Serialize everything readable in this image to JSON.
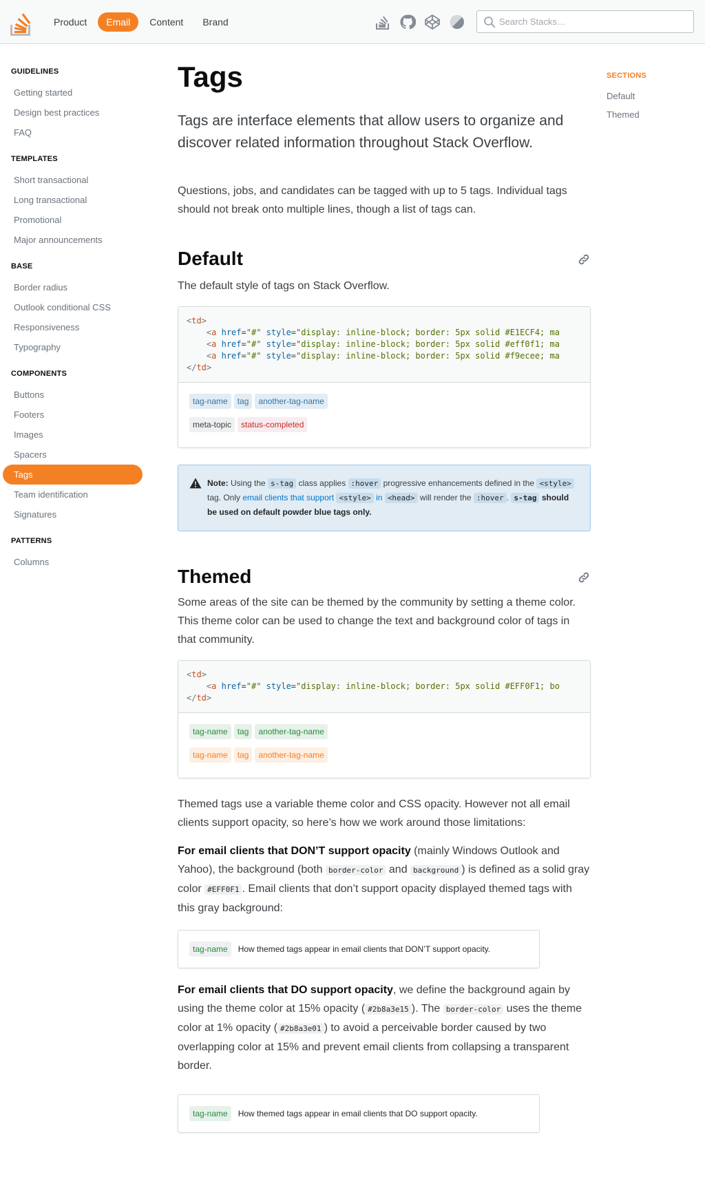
{
  "header": {
    "nav": [
      {
        "label": "Product",
        "active": false
      },
      {
        "label": "Email",
        "active": true
      },
      {
        "label": "Content",
        "active": false
      },
      {
        "label": "Brand",
        "active": false
      }
    ],
    "tool_icons": [
      "stack-overflow-icon",
      "github-icon",
      "codepen-icon",
      "theme-toggle-icon"
    ],
    "search": {
      "placeholder": "Search Stacks…",
      "value": ""
    }
  },
  "sidebar": {
    "groups": [
      {
        "heading": "GUIDELINES",
        "items": [
          "Getting started",
          "Design best practices",
          "FAQ"
        ]
      },
      {
        "heading": "TEMPLATES",
        "items": [
          "Short transactional",
          "Long transactional",
          "Promotional",
          "Major announcements"
        ]
      },
      {
        "heading": "BASE",
        "items": [
          "Border radius",
          "Outlook conditional CSS",
          "Responsiveness",
          "Typography"
        ]
      },
      {
        "heading": "COMPONENTS",
        "items": [
          "Buttons",
          "Footers",
          "Images",
          "Spacers",
          "Tags",
          "Team identification",
          "Signatures"
        ]
      },
      {
        "heading": "PATTERNS",
        "items": [
          "Columns"
        ]
      }
    ],
    "active_item": "Tags"
  },
  "sections": {
    "heading": "SECTIONS",
    "items": [
      "Default",
      "Themed"
    ]
  },
  "page": {
    "title": "Tags",
    "lead": "Tags are interface elements that allow users to organize and discover related information throughout Stack Overflow.",
    "intro": "Questions, jobs, and candidates can be tagged with up to 5 tags. Individual tags should not break onto multiple lines, though a list of tags can."
  },
  "default_section": {
    "title": "Default",
    "description": "The default style of tags on Stack Overflow.",
    "code": {
      "open": "td",
      "lines": [
        {
          "tag": "a",
          "href": "\"#\"",
          "style": "\"display: inline-block; border: 5px solid #E1ECF4; ma"
        },
        {
          "tag": "a",
          "href": "\"#\"",
          "style": "\"display: inline-block; border: 5px solid #eff0f1; ma"
        },
        {
          "tag": "a",
          "href": "\"#\"",
          "style": "\"display: inline-block; border: 5px solid #f9ecee; ma"
        }
      ],
      "close": "td"
    },
    "tag_rows": [
      [
        {
          "label": "tag-name",
          "bg": "#E1ECF4",
          "color": "#39739d"
        },
        {
          "label": "tag",
          "bg": "#E1ECF4",
          "color": "#39739d"
        },
        {
          "label": "another-tag-name",
          "bg": "#E1ECF4",
          "color": "#39739d"
        }
      ],
      [
        {
          "label": "meta-topic",
          "bg": "#eff0f1",
          "color": "#3b4045"
        },
        {
          "label": "status-completed",
          "bg": "#f9ecee",
          "color": "#c02d2e"
        }
      ]
    ]
  },
  "note": {
    "bold_prefix": "Note:",
    "t1": " Using the ",
    "c1": "s-tag",
    "t2": " class applies ",
    "c2": ":hover",
    "t3": " progressive enhancements defined in the ",
    "c3": "<style>",
    "t4": " tag. Only ",
    "link": "email clients that support",
    "t5": " ",
    "c4": "<style>",
    "link2": " in ",
    "c5": "<head>",
    "t6": " will render the ",
    "c6": ":hover",
    "t7": ". ",
    "c7": "s-tag",
    "bold_suffix": " should be used on default powder blue tags only."
  },
  "themed_section": {
    "title": "Themed",
    "description": "Some areas of the site can be themed by the community by setting a theme color. This theme color can be used to change the text and background color of tags in that community.",
    "code": {
      "open": "td",
      "lines": [
        {
          "tag": "a",
          "href": "\"#\"",
          "style": "\"display: inline-block; border: 5px solid #EFF0F1; bo"
        }
      ],
      "close": "td"
    },
    "tag_rows": [
      [
        {
          "label": "tag-name",
          "bg": "#e6f1e9",
          "color": "#2b8a3e"
        },
        {
          "label": "tag",
          "bg": "#e6f1e9",
          "color": "#2b8a3e"
        },
        {
          "label": "another-tag-name",
          "bg": "#e6f1e9",
          "color": "#2b8a3e"
        }
      ],
      [
        {
          "label": "tag-name",
          "bg": "#fdefe3",
          "color": "#f48024"
        },
        {
          "label": "tag",
          "bg": "#fdefe3",
          "color": "#f48024"
        },
        {
          "label": "another-tag-name",
          "bg": "#fdefe3",
          "color": "#f48024"
        }
      ]
    ],
    "opacity_intro": "Themed tags use a variable theme color and CSS opacity. However not all email clients support opacity, so here’s how we work around those limitations:",
    "no_opacity": {
      "bold": "For email clients that DON’T support opacity",
      "t1": " (mainly Windows Outlook and Yahoo), the background (both ",
      "c1": "border-color",
      "t2": " and ",
      "c2": "background",
      "t3": ") is defined as a solid gray color ",
      "c3": "#EFF0F1",
      "t4": ". Email clients that don’t support opacity displayed themed tags with this gray background:"
    },
    "no_opacity_sample": {
      "tag": "tag-name",
      "caption": "How themed tags appear in email clients that DON’T support opacity."
    },
    "with_opacity": {
      "bold": "For email clients that DO support opacity",
      "t1": ", we define the background again by using the theme color at 15% opacity (",
      "c1": "#2b8a3e15",
      "t2": "). The ",
      "c2": "border-color",
      "t3": " uses the theme color at 1% opacity (",
      "c3": "#2b8a3e01",
      "t4": ") to avoid a perceivable border caused by two overlapping color at 15% and prevent email clients from collapsing a transparent border."
    },
    "with_opacity_sample": {
      "tag": "tag-name",
      "caption": "How themed tags appear in email clients that DO support opacity."
    }
  },
  "colors": {
    "accent": "#f48024",
    "tag_default_bg": "#E1ECF4",
    "tag_default_text": "#39739d",
    "note_bg": "#e1ecf4",
    "theme_green": "#2b8a3e"
  }
}
